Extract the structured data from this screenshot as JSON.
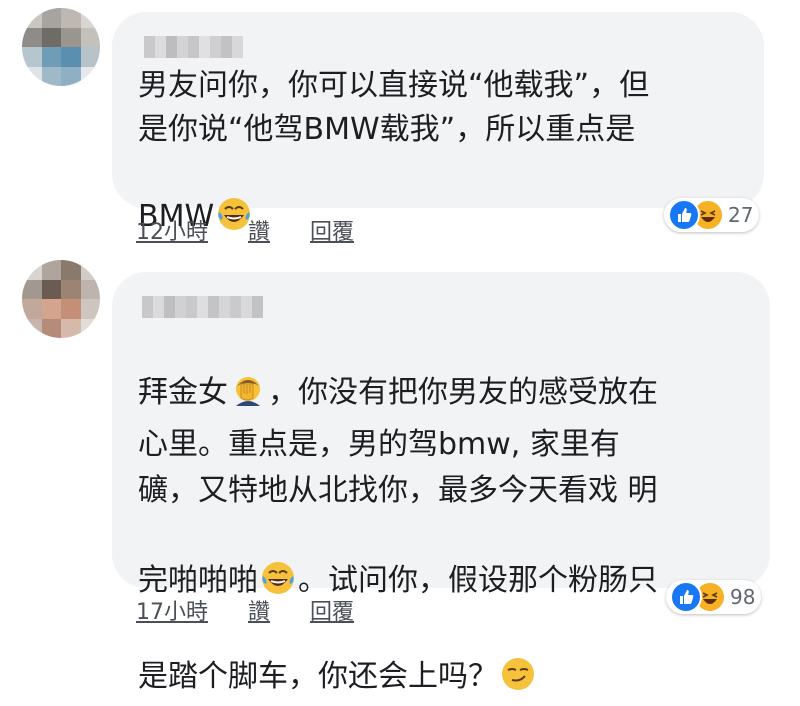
{
  "colors": {
    "bubble": "#f2f3f5",
    "text": "#1c1e21",
    "meta": "#4b4f56",
    "like": "#1877f2",
    "haha": "#f7b125"
  },
  "comments": [
    {
      "text": "男友问你，你可以直接说“他载我”，但\n是你说“他驾BMW载我”，所以重点是\nBMW",
      "trailing_emoji": "laughing-tears-icon",
      "time": "12小時",
      "like_label": "讚",
      "reply_label": "回覆",
      "reaction_count": "27"
    },
    {
      "text_parts": [
        "拜金女",
        "，你没有把你男友的感受放在\n心里。重点是，男的驾bmw, 家里有\n礦，又特地从北找你，最多今天看戏 明\n完啪啪啪",
        "。试问你，假设那个粉肠只\n是踏个脚车，你还会上吗？"
      ],
      "inline_emojis": [
        "facepalm-icon",
        "laughing-tears-icon",
        "smirk-icon"
      ],
      "time": "17小時",
      "like_label": "讚",
      "reply_label": "回覆",
      "reaction_count": "98"
    }
  ]
}
